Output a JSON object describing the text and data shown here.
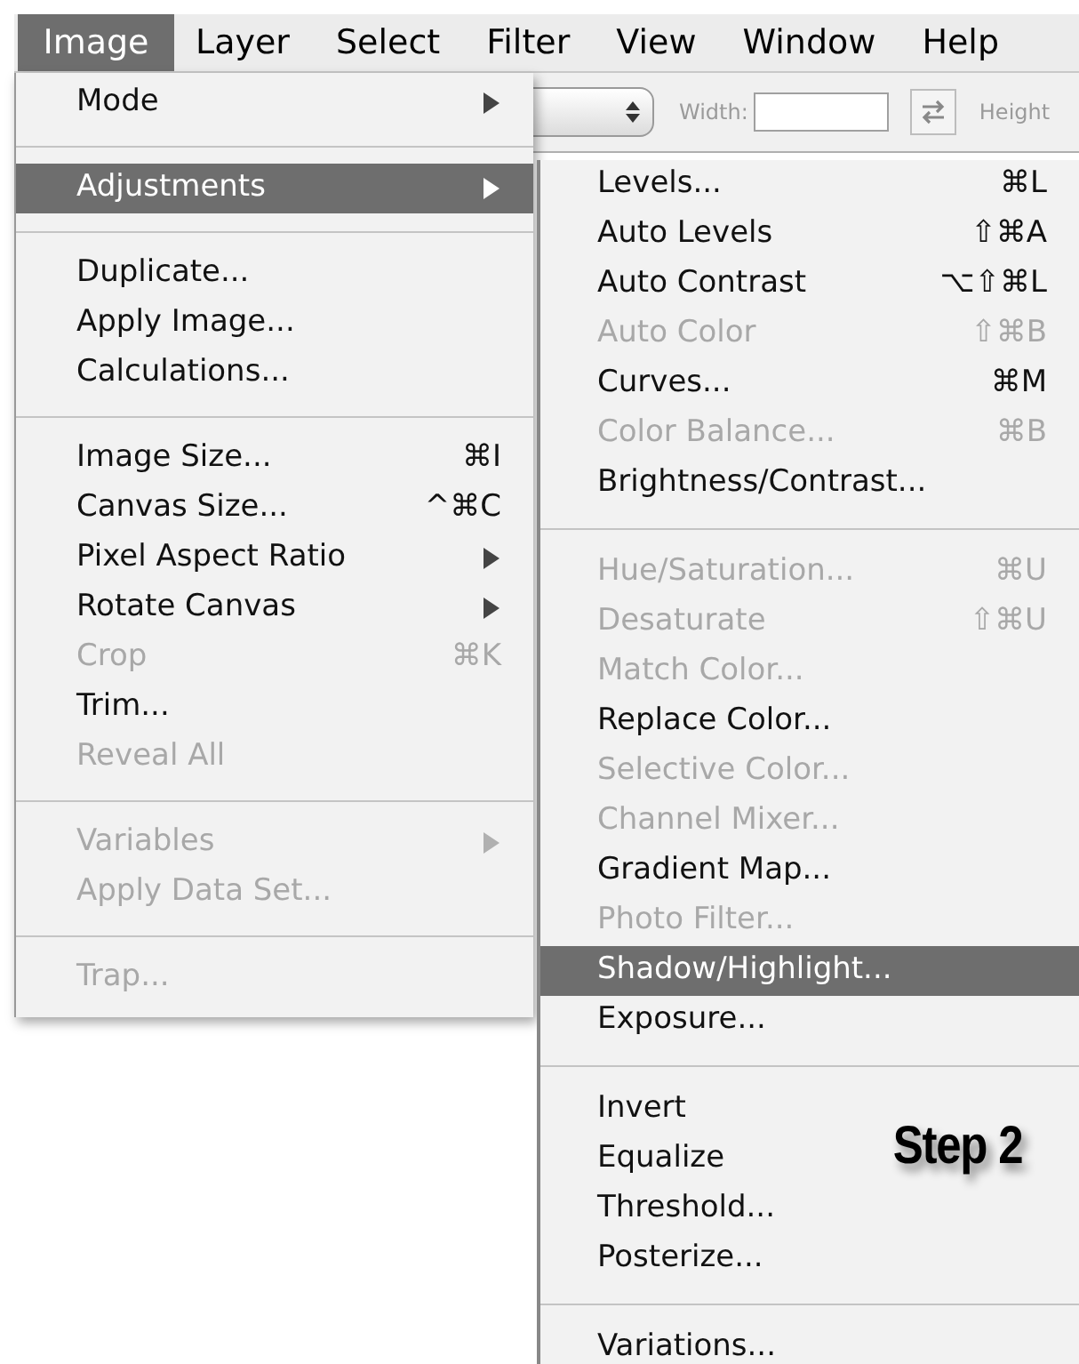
{
  "menu_bar": [
    {
      "label": "Image",
      "selected": true
    },
    {
      "label": "Layer",
      "selected": false
    },
    {
      "label": "Select",
      "selected": false
    },
    {
      "label": "Filter",
      "selected": false
    },
    {
      "label": "View",
      "selected": false
    },
    {
      "label": "Window",
      "selected": false
    },
    {
      "label": "Help",
      "selected": false
    }
  ],
  "toolbar": {
    "width_label": "Width:",
    "height_label": "Height"
  },
  "image_menu": {
    "items": [
      {
        "kind": "item",
        "label": "Mode",
        "has_submenu": true,
        "disabled": false,
        "selected": false
      },
      {
        "kind": "separator"
      },
      {
        "kind": "item",
        "label": "Adjustments",
        "has_submenu": true,
        "disabled": false,
        "selected": true
      },
      {
        "kind": "separator"
      },
      {
        "kind": "item",
        "label": "Duplicate...",
        "disabled": false,
        "selected": false
      },
      {
        "kind": "item",
        "label": "Apply Image...",
        "disabled": false,
        "selected": false
      },
      {
        "kind": "item",
        "label": "Calculations...",
        "disabled": false,
        "selected": false
      },
      {
        "kind": "separator"
      },
      {
        "kind": "item",
        "label": "Image Size...",
        "shortcut": "⌘I",
        "disabled": false,
        "selected": false
      },
      {
        "kind": "item",
        "label": "Canvas Size...",
        "shortcut": "^⌘C",
        "disabled": false,
        "selected": false
      },
      {
        "kind": "item",
        "label": "Pixel Aspect Ratio",
        "has_submenu": true,
        "disabled": false,
        "selected": false
      },
      {
        "kind": "item",
        "label": "Rotate Canvas",
        "has_submenu": true,
        "disabled": false,
        "selected": false
      },
      {
        "kind": "item",
        "label": "Crop",
        "shortcut": "⌘K",
        "disabled": true,
        "selected": false
      },
      {
        "kind": "item",
        "label": "Trim...",
        "disabled": false,
        "selected": false
      },
      {
        "kind": "item",
        "label": "Reveal All",
        "disabled": true,
        "selected": false
      },
      {
        "kind": "separator"
      },
      {
        "kind": "item",
        "label": "Variables",
        "has_submenu": true,
        "disabled": true,
        "selected": false
      },
      {
        "kind": "item",
        "label": "Apply Data Set...",
        "disabled": true,
        "selected": false
      },
      {
        "kind": "separator"
      },
      {
        "kind": "item",
        "label": "Trap...",
        "disabled": true,
        "selected": false
      }
    ]
  },
  "adjustments_submenu": {
    "items": [
      {
        "kind": "item",
        "label": "Levels...",
        "shortcut": "⌘L",
        "disabled": false,
        "selected": false
      },
      {
        "kind": "item",
        "label": "Auto Levels",
        "shortcut": "⇧⌘A",
        "disabled": false,
        "selected": false
      },
      {
        "kind": "item",
        "label": "Auto Contrast",
        "shortcut": "⌥⇧⌘L",
        "disabled": false,
        "selected": false
      },
      {
        "kind": "item",
        "label": "Auto Color",
        "shortcut": "⇧⌘B",
        "disabled": true,
        "selected": false
      },
      {
        "kind": "item",
        "label": "Curves...",
        "shortcut": "⌘M",
        "disabled": false,
        "selected": false
      },
      {
        "kind": "item",
        "label": "Color Balance...",
        "shortcut": "⌘B",
        "disabled": true,
        "selected": false
      },
      {
        "kind": "item",
        "label": "Brightness/Contrast...",
        "disabled": false,
        "selected": false
      },
      {
        "kind": "separator"
      },
      {
        "kind": "item",
        "label": "Hue/Saturation...",
        "shortcut": "⌘U",
        "disabled": true,
        "selected": false
      },
      {
        "kind": "item",
        "label": "Desaturate",
        "shortcut": "⇧⌘U",
        "disabled": true,
        "selected": false
      },
      {
        "kind": "item",
        "label": "Match Color...",
        "disabled": true,
        "selected": false
      },
      {
        "kind": "item",
        "label": "Replace Color...",
        "disabled": false,
        "selected": false
      },
      {
        "kind": "item",
        "label": "Selective Color...",
        "disabled": true,
        "selected": false
      },
      {
        "kind": "item",
        "label": "Channel Mixer...",
        "disabled": true,
        "selected": false
      },
      {
        "kind": "item",
        "label": "Gradient Map...",
        "disabled": false,
        "selected": false
      },
      {
        "kind": "item",
        "label": "Photo Filter...",
        "disabled": true,
        "selected": false
      },
      {
        "kind": "item",
        "label": "Shadow/Highlight...",
        "disabled": false,
        "selected": true
      },
      {
        "kind": "item",
        "label": "Exposure...",
        "disabled": false,
        "selected": false
      },
      {
        "kind": "separator"
      },
      {
        "kind": "item",
        "label": "Invert",
        "disabled": false,
        "selected": false
      },
      {
        "kind": "item",
        "label": "Equalize",
        "disabled": false,
        "selected": false
      },
      {
        "kind": "item",
        "label": "Threshold...",
        "disabled": false,
        "selected": false
      },
      {
        "kind": "item",
        "label": "Posterize...",
        "disabled": false,
        "selected": false
      },
      {
        "kind": "separator"
      },
      {
        "kind": "item",
        "label": "Variations...",
        "disabled": false,
        "selected": false
      }
    ]
  },
  "annotation": {
    "text": "Step 2"
  }
}
